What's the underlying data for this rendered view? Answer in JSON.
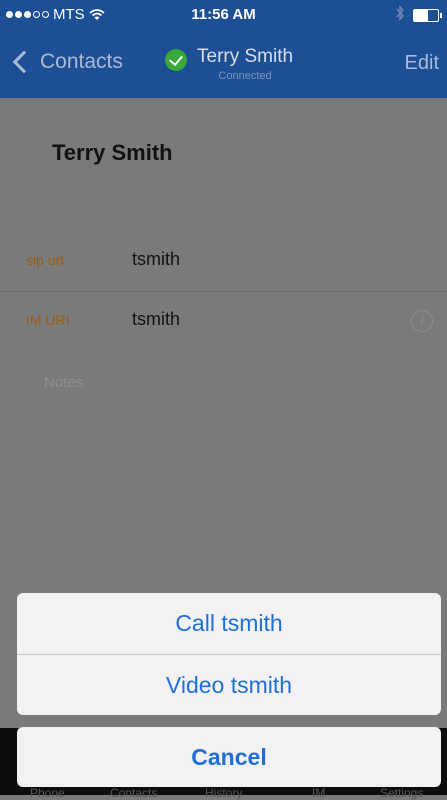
{
  "status_bar": {
    "carrier": "MTS",
    "signal_dots_filled": 3,
    "signal_dots_total": 5,
    "time": "11:56 AM",
    "bluetooth_icon": "bluetooth-icon",
    "battery_icon": "battery-icon"
  },
  "nav": {
    "back_label": "Contacts",
    "title": "Terry Smith",
    "subtitle": "Connected",
    "edit_label": "Edit",
    "status_color": "#3aa83a",
    "bar_color": "#1d4f94"
  },
  "contact": {
    "name": "Terry Smith",
    "fields": [
      {
        "label": "sip url",
        "value": "tsmith"
      },
      {
        "label": "IM URI",
        "value": "tsmith"
      }
    ],
    "notes_label": "Notes"
  },
  "tabbar": {
    "tabs": [
      "Phone",
      "Contacts",
      "History",
      "IM",
      "Settings"
    ]
  },
  "action_sheet": {
    "call_label": "Call tsmith",
    "video_label": "Video tsmith",
    "cancel_label": "Cancel",
    "accent_color": "#1f6fd6"
  }
}
